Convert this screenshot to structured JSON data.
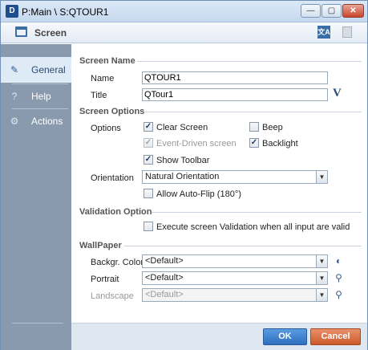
{
  "window": {
    "app_icon": "D",
    "title": "P:Main \\ S:QTOUR1",
    "min_glyph": "—",
    "max_glyph": "▢",
    "close_glyph": "✕"
  },
  "header": {
    "title": "Screen",
    "icons": [
      "screen-icon",
      "translate-icon",
      "note-icon"
    ]
  },
  "sidebar": {
    "items": [
      {
        "label": "General",
        "icon": "✎",
        "active": true
      },
      {
        "label": "Help",
        "icon": "?",
        "active": false
      },
      {
        "label": "Actions",
        "icon": "⚙",
        "active": false
      }
    ]
  },
  "screen_name": {
    "section": "Screen Name",
    "name_label": "Name",
    "name_value": "QTOUR1",
    "title_label": "Title",
    "title_value": "QTour1",
    "title_btn": "V"
  },
  "screen_options": {
    "section": "Screen Options",
    "options_label": "Options",
    "clear_screen": {
      "label": "Clear Screen",
      "checked": "✓"
    },
    "beep": {
      "label": "Beep",
      "checked": ""
    },
    "event_driven": {
      "label": "Event-Driven screen",
      "checked": "✓"
    },
    "backlight": {
      "label": "Backlight",
      "checked": "✓"
    },
    "show_toolbar": {
      "label": "Show Toolbar",
      "checked": "✓"
    },
    "orientation_label": "Orientation",
    "orientation_value": "Natural Orientation",
    "auto_flip": {
      "label": "Allow Auto-Flip (180°)",
      "checked": ""
    }
  },
  "validation": {
    "section": "Validation Option",
    "execute": {
      "label": "Execute screen Validation when all input are valid",
      "checked": ""
    }
  },
  "wallpaper": {
    "section": "WallPaper",
    "backgr_label": "Backgr. Color",
    "backgr_value": "<Default>",
    "portrait_label": "Portrait",
    "portrait_value": "<Default>",
    "landscape_label": "Landscape",
    "landscape_value": "<Default>",
    "arrow": "▼",
    "color_btn": "◐",
    "search_btn": "⚲"
  },
  "footer": {
    "ok_label": "OK",
    "cancel_label": "Cancel"
  }
}
